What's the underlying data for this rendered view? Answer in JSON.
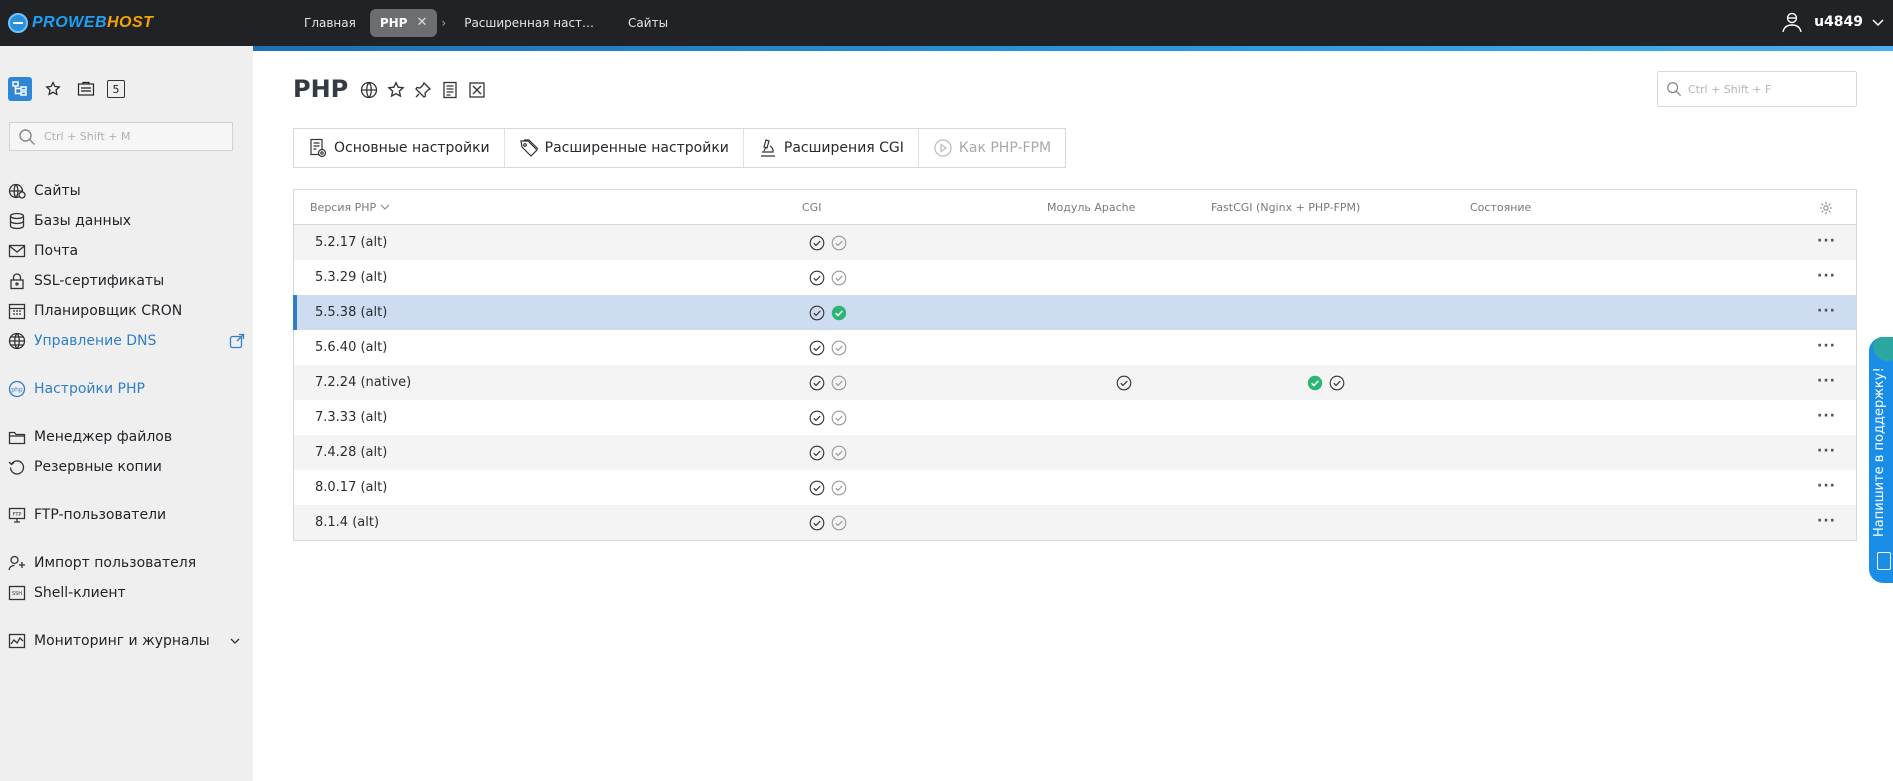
{
  "brand": {
    "logo_pre": "PROWEB",
    "logo_post": "HOST"
  },
  "topbar": {
    "tabs": [
      "Главная",
      "PHP",
      "Расширенная наст…",
      "Сайты"
    ],
    "user": "u4849"
  },
  "sidebar": {
    "search_placeholder": "Ctrl + Shift + M",
    "badge": "5",
    "items": [
      {
        "label": "Сайты",
        "icon": "sites-icon"
      },
      {
        "label": "Базы данных",
        "icon": "database-icon"
      },
      {
        "label": "Почта",
        "icon": "mail-icon"
      },
      {
        "label": "SSL-сертификаты",
        "icon": "lock-icon"
      },
      {
        "label": "Планировщик CRON",
        "icon": "calendar-icon"
      },
      {
        "label": "Управление DNS",
        "icon": "globe-icon"
      },
      {
        "label": "Настройки PHP",
        "icon": "php-icon"
      },
      {
        "label": "Менеджер файлов",
        "icon": "folder-icon"
      },
      {
        "label": "Резервные копии",
        "icon": "backup-icon"
      },
      {
        "label": "FTP-пользователи",
        "icon": "ftp-icon"
      },
      {
        "label": "Импорт пользователя",
        "icon": "user-import-icon"
      },
      {
        "label": "Shell-клиент",
        "icon": "ssh-icon"
      },
      {
        "label": "Мониторинг и журналы",
        "icon": "monitoring-icon"
      }
    ]
  },
  "main": {
    "title": "PHP",
    "search_placeholder": "Ctrl + Shift + F",
    "toolbar": {
      "basic": "Основные настройки",
      "advanced": "Расширенные настройки",
      "cgi_ext": "Расширения CGI",
      "as_fpm": "Как PHP-FPM"
    },
    "table": {
      "columns": {
        "version": "Версия PHP",
        "cgi": "CGI",
        "apache": "Модуль Apache",
        "fastcgi": "FastCGI (Nginx + PHP-FPM)",
        "state": "Состояние"
      },
      "rows": [
        {
          "version": "5.2.17 (alt)",
          "cgi_default": false,
          "apache": false,
          "fastcgi": false
        },
        {
          "version": "5.3.29 (alt)",
          "cgi_default": false,
          "apache": false,
          "fastcgi": false
        },
        {
          "version": "5.5.38 (alt)",
          "cgi_default": true,
          "apache": false,
          "fastcgi": false,
          "selected": true
        },
        {
          "version": "5.6.40 (alt)",
          "cgi_default": false,
          "apache": false,
          "fastcgi": false
        },
        {
          "version": "7.2.24 (native)",
          "cgi_default": false,
          "apache": true,
          "fastcgi": true
        },
        {
          "version": "7.3.33 (alt)",
          "cgi_default": false,
          "apache": false,
          "fastcgi": false
        },
        {
          "version": "7.4.28 (alt)",
          "cgi_default": false,
          "apache": false,
          "fastcgi": false
        },
        {
          "version": "8.0.17 (alt)",
          "cgi_default": false,
          "apache": false,
          "fastcgi": false
        },
        {
          "version": "8.1.4 (alt)",
          "cgi_default": false,
          "apache": false,
          "fastcgi": false
        }
      ],
      "row_menu": "···"
    }
  },
  "support": {
    "label": "Напишите в поддержку!"
  },
  "colors": {
    "accent": "#2f86d6",
    "topbar": "#212225",
    "sidebar": "#efefef",
    "selected_row": "#cddcf0",
    "check_green": "#2bb673"
  }
}
